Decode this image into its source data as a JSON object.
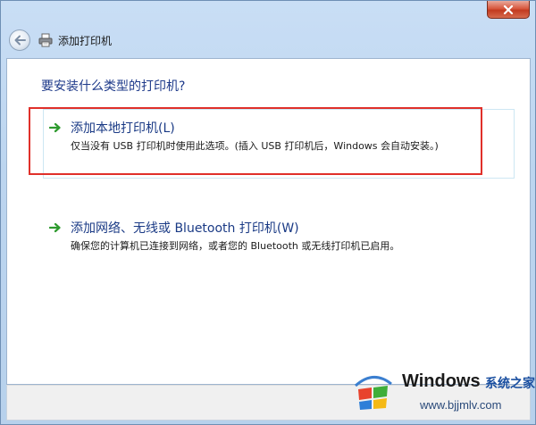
{
  "window": {
    "title": "添加打印机"
  },
  "main": {
    "question": "要安装什么类型的打印机?",
    "options": [
      {
        "title": "添加本地打印机(L)",
        "description": "仅当没有 USB 打印机时使用此选项。(插入 USB 打印机后，Windows 会自动安装。)"
      },
      {
        "title": "添加网络、无线或 Bluetooth 打印机(W)",
        "description": "确保您的计算机已连接到网络，或者您的 Bluetooth 或无线打印机已启用。"
      }
    ]
  },
  "watermark": {
    "brand": "Windows",
    "site_name": "系统之家",
    "url": "www.bjjmlv.com"
  },
  "colors": {
    "title_link": "#1a3a85",
    "highlight": "#e0302a",
    "arrow": "#2e9a2e"
  }
}
